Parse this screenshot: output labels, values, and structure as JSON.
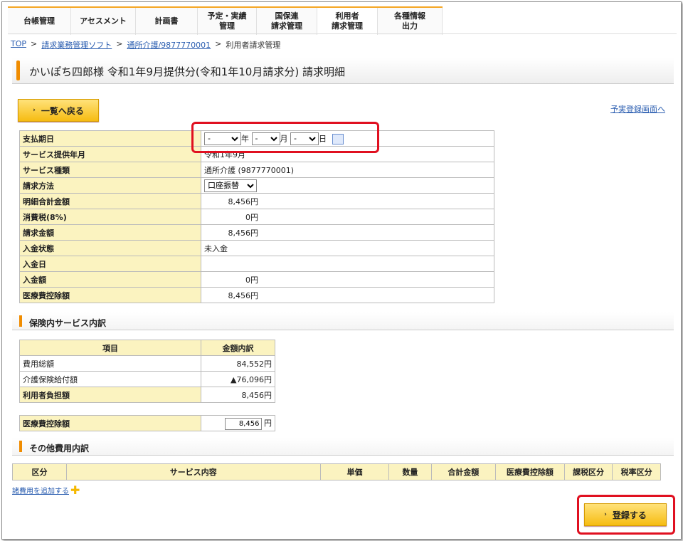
{
  "nav": {
    "items": [
      {
        "label": "台帳管理"
      },
      {
        "label": "アセスメント"
      },
      {
        "label": "計画書"
      },
      {
        "label": "予定・実績\n管理"
      },
      {
        "label": "国保連\n請求管理"
      },
      {
        "label": "利用者\n請求管理"
      },
      {
        "label": "各種情報\n出力"
      }
    ]
  },
  "breadcrumb": {
    "top": "TOP",
    "sep": ">",
    "soft": "請求業務管理ソフト",
    "service": "通所介護/9877770001",
    "current": "利用者請求管理"
  },
  "page_title": "かいぽち四郎様 令和1年9月提供分(令和1年10月請求分) 請求明細",
  "back_button": "一覧へ戻る",
  "schedule_link": "予実登録画面へ",
  "detail": {
    "pay_date_label": "支払期日",
    "pay_year_value": "-",
    "pay_year_unit": "年",
    "pay_month_value": "-",
    "pay_month_unit": "月",
    "pay_day_value": "-",
    "pay_day_unit": "日",
    "service_month_label": "サービス提供年月",
    "service_month_value": "令和1年9月",
    "service_type_label": "サービス種類",
    "service_type_value": "通所介護 (9877770001)",
    "billing_method_label": "請求方法",
    "billing_method_value": "口座振替",
    "detail_total_label": "明細合計金額",
    "detail_total_value": "8,456円",
    "tax_label": "消費税(8%)",
    "tax_value": "0円",
    "billing_amount_label": "請求金額",
    "billing_amount_value": "8,456円",
    "payment_status_label": "入金状態",
    "payment_status_value": "未入金",
    "payment_date_label": "入金日",
    "payment_date_value": "",
    "payment_amount_label": "入金額",
    "payment_amount_value": "0円",
    "medical_deduction_label": "医療費控除額",
    "medical_deduction_value": "8,456円"
  },
  "insurance_section": {
    "title": "保険内サービス内訳",
    "col_item": "項目",
    "col_amount": "金額内訳",
    "rows": [
      {
        "label": "費用総額",
        "value": "84,552円"
      },
      {
        "label": "介護保険給付額",
        "value": "▲76,096円"
      },
      {
        "label": "利用者負担額",
        "value": "8,456円"
      }
    ]
  },
  "deduction": {
    "label": "医療費控除額",
    "value": "8,456",
    "unit": "円"
  },
  "other_section": {
    "title": "その他費用内訳",
    "columns": [
      "区分",
      "サービス内容",
      "単価",
      "数量",
      "合計金額",
      "医療費控除額",
      "課税区分",
      "税率区分"
    ],
    "add_link": "諸費用を追加する"
  },
  "register_button": "登録する",
  "colors": {
    "accent": "#f08c00",
    "label_bg": "#fbf3c0",
    "highlight": "#e01020",
    "link": "#2a5db0"
  }
}
